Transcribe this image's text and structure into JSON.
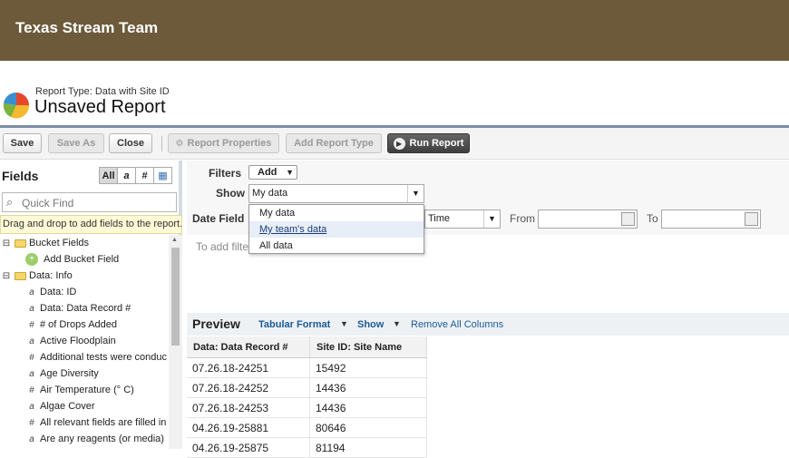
{
  "banner": {
    "title": "Texas Stream Team"
  },
  "report": {
    "type_label": "Report Type: Data with Site ID",
    "name": "Unsaved Report"
  },
  "toolbar": {
    "save": "Save",
    "save_as": "Save As",
    "close": "Close",
    "report_properties": "Report Properties",
    "add_report_type": "Add Report Type",
    "run_report": "Run Report"
  },
  "fields_panel": {
    "title": "Fields",
    "type_buttons": [
      "All",
      "a",
      "#",
      "▦"
    ],
    "quick_find_placeholder": "Quick Find",
    "hint": "Drag and drop to add fields to the report.",
    "tree": [
      {
        "label": "Bucket Fields",
        "icon": "folder-icon"
      },
      {
        "label": "Add Bucket Field",
        "icon": "add-bucket-icon"
      },
      {
        "label": "Data: Info",
        "icon": "folder-icon"
      },
      {
        "label": "Data: ID",
        "icon": "a"
      },
      {
        "label": "Data: Data Record #",
        "icon": "a"
      },
      {
        "label": "# of Drops Added",
        "icon": "#"
      },
      {
        "label": "Active Floodplain",
        "icon": "a"
      },
      {
        "label": "Additional tests were conduc",
        "icon": "#"
      },
      {
        "label": "Age Diversity",
        "icon": "a"
      },
      {
        "label": "Air Temperature (° C)",
        "icon": "#"
      },
      {
        "label": "Algae Cover",
        "icon": "a"
      },
      {
        "label": "All relevant fields are filled in",
        "icon": "#"
      },
      {
        "label": "Are any reagents (or media)",
        "icon": "a"
      }
    ]
  },
  "filters": {
    "filters_label": "Filters",
    "add_label": "Add",
    "show_label": "Show",
    "show_value": "My data",
    "show_options": [
      "My data",
      "My team's data",
      "All data"
    ],
    "highlighted_option": "My team's data",
    "date_field_label": "Date Field",
    "range_value": "Time",
    "from_label": "From",
    "to_label": "To",
    "add_filter_hint": "To add filte"
  },
  "preview": {
    "title": "Preview",
    "format_link": "Tabular Format",
    "show_link": "Show",
    "remove_link": "Remove All Columns",
    "columns": [
      "Data: Data Record #",
      "Site ID: Site Name"
    ],
    "rows": [
      [
        "07.26.18-24251",
        "15492"
      ],
      [
        "07.26.18-24252",
        "14436"
      ],
      [
        "07.26.18-24253",
        "14436"
      ],
      [
        "04.26.19-25881",
        "80646"
      ],
      [
        "04.26.19-25875",
        "81194"
      ]
    ]
  }
}
